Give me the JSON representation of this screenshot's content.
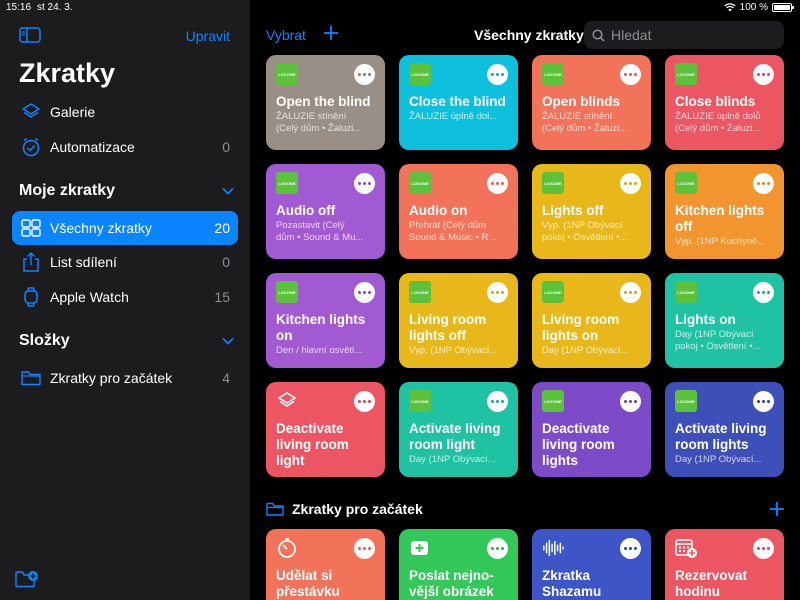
{
  "status": {
    "time": "15:16",
    "date": "st 24. 3.",
    "battery": "100 %",
    "battery_level": 1.0
  },
  "sidebar": {
    "edit_label": "Upravit",
    "title": "Zkratky",
    "top_items": [
      {
        "label": "Galerie",
        "count": ""
      },
      {
        "label": "Automatizace",
        "count": "0"
      }
    ],
    "my_section": "Moje zkratky",
    "my_items": [
      {
        "label": "Všechny zkratky",
        "count": "20"
      },
      {
        "label": "List sdílení",
        "count": "0"
      },
      {
        "label": "Apple Watch",
        "count": "15"
      }
    ],
    "folders_section": "Složky",
    "folder_items": [
      {
        "label": "Zkratky pro začátek",
        "count": "4"
      }
    ]
  },
  "topbar": {
    "select_label": "Vybrat",
    "title": "Všechny zkratky",
    "search_placeholder": "Hledat"
  },
  "colors": {
    "accent": "#0a84ff",
    "gray": "#9a8f86",
    "cyan": "#0fc0dc",
    "coral": "#f2725a",
    "red": "#ec5662",
    "purple": "#a25ad2",
    "yellow": "#e8b81a",
    "orange": "#f2952f",
    "teal": "#1fc2a3",
    "violet": "#7e4bc8",
    "indigo": "#3d4fb8",
    "green": "#34c759",
    "blue": "#3d55c6"
  },
  "logo_text": "LOXONE",
  "cards": [
    {
      "name": "Open the blind",
      "sub": "ŽALUZIE stínění",
      "sub2": "(Celý dům • Žaluzi...",
      "color": "gray",
      "dot": "#8a7f78",
      "icon": "loxone-logo"
    },
    {
      "name": "Close the blind",
      "sub": "ŽALUZIE úplně dol...",
      "sub2": "",
      "color": "cyan",
      "dot": "#0fa8c2",
      "icon": "loxone-logo"
    },
    {
      "name": "Open blinds",
      "sub": "ŽALUZIE stínění",
      "sub2": "(Celý dům • Žaluzi...",
      "color": "coral",
      "dot": "#e0604a",
      "icon": "loxone-logo"
    },
    {
      "name": "Close blinds",
      "sub": "ŽALUZIE úplně dolů",
      "sub2": "(Celý dům • Žaluzi...",
      "color": "red",
      "dot": "#dc4654",
      "icon": "loxone-logo"
    },
    {
      "name": "Audio off",
      "sub": "Pozastavit (Celý",
      "sub2": "dům • Sound & Mu...",
      "color": "purple",
      "dot": "#9048c2",
      "icon": "loxone-logo"
    },
    {
      "name": "Audio on",
      "sub": "Přehrát (Celý dům",
      "sub2": "Sound & Music • R...",
      "color": "coral",
      "dot": "#e0604a",
      "icon": "loxone-logo"
    },
    {
      "name": "Lights off",
      "sub": "Vyp. (1NP Obývací",
      "sub2": "pokoj • Osvětlení •...",
      "color": "yellow",
      "dot": "#d6a810",
      "icon": "loxone-logo"
    },
    {
      "name": "Kitchen lights off",
      "sub": "Vyp. (1NP Kuchyně...",
      "sub2": "",
      "color": "orange",
      "dot": "#e0851f",
      "icon": "loxone-logo"
    },
    {
      "name": "Kitchen lights on",
      "sub": "Den / hlavní osvětl...",
      "sub2": "",
      "color": "purple",
      "dot": "#9048c2",
      "icon": "loxone-logo"
    },
    {
      "name": "Living room lights off",
      "sub": "Vyp. (1NP Obývací...",
      "sub2": "",
      "color": "yellow",
      "dot": "#d6a810",
      "icon": "loxone-logo"
    },
    {
      "name": "Living room lights on",
      "sub": "Day (1NP Obývací...",
      "sub2": "",
      "color": "yellow",
      "dot": "#d6a810",
      "icon": "loxone-logo"
    },
    {
      "name": "Lights on",
      "sub": "Day (1NP Obývací",
      "sub2": "pokoj • Osvětlení •...",
      "color": "teal",
      "dot": "#14ae90",
      "icon": "loxone-logo"
    },
    {
      "name": "Deactivate living room light",
      "sub": "",
      "sub2": "",
      "color": "red",
      "dot": "#dc4654",
      "icon": "layers-icon"
    },
    {
      "name": "Activate living room light",
      "sub": "Day (1NP Obývací...",
      "sub2": "",
      "color": "teal",
      "dot": "#14ae90",
      "icon": "loxone-logo"
    },
    {
      "name": "Deactivate living room lights",
      "sub": "",
      "sub2": "",
      "color": "violet",
      "dot": "#6e3db8",
      "icon": "loxone-logo"
    },
    {
      "name": "Activate living room lights",
      "sub": "Day (1NP Obývací...",
      "sub2": "",
      "color": "indigo",
      "dot": "#2f40a6",
      "icon": "loxone-logo"
    }
  ],
  "folder": {
    "title": "Zkratky pro začátek"
  },
  "folder_cards": [
    {
      "name": "Udělat si přestávku",
      "color": "coral",
      "dot": "#e0604a",
      "icon": "timer-icon"
    },
    {
      "name": "Poslat nejno-vější obrázek",
      "color": "green",
      "dot": "#28b14b",
      "icon": "photo-plus-icon"
    },
    {
      "name": "Zkratka Shazamu",
      "color": "blue",
      "dot": "#2f45b2",
      "icon": "waveform-icon"
    },
    {
      "name": "Rezervovat hodinu",
      "color": "red",
      "dot": "#dc4654",
      "icon": "calendar-plus-icon"
    }
  ]
}
